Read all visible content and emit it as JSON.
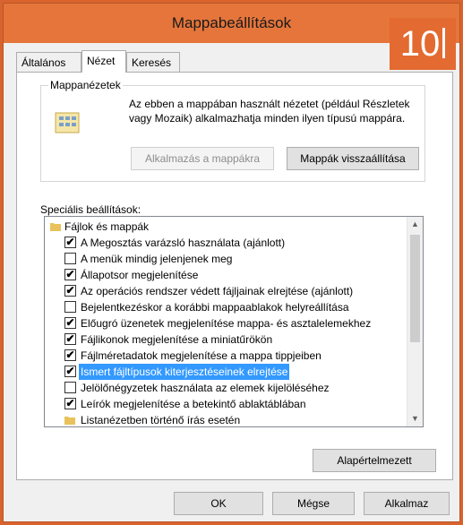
{
  "window": {
    "title": "Mappabeállítások",
    "badge": "10"
  },
  "tabs": [
    {
      "label": "Általános"
    },
    {
      "label": "Nézet"
    },
    {
      "label": "Keresés"
    }
  ],
  "folder_views": {
    "group_label": "Mappanézetek",
    "description": "Az ebben a mappában használt nézetet (például Részletek vagy Mozaik) alkalmazhatja minden ilyen típusú mappára.",
    "apply_button": "Alkalmazás a mappákra",
    "reset_button": "Mappák visszaállítása"
  },
  "advanced": {
    "label": "Speciális beállítások:",
    "items": [
      {
        "type": "folder",
        "label": "Fájlok és mappák"
      },
      {
        "type": "checkbox",
        "checked": "✔",
        "label": "A Megosztás varázsló használata (ajánlott)"
      },
      {
        "type": "checkbox",
        "checked": "",
        "label": "A menük mindig jelenjenek meg"
      },
      {
        "type": "checkbox",
        "checked": "✔",
        "label": "Állapotsor megjelenítése"
      },
      {
        "type": "checkbox",
        "checked": "✔",
        "label": "Az operációs rendszer védett fájljainak elrejtése (ajánlott)"
      },
      {
        "type": "checkbox",
        "checked": "",
        "label": "Bejelentkezéskor a korábbi mappaablakok helyreállítása"
      },
      {
        "type": "checkbox",
        "checked": "✔",
        "label": "Előugró üzenetek megjelenítése mappa- és asztalelemekhez"
      },
      {
        "type": "checkbox",
        "checked": "✔",
        "label": "Fájlikonok megjelenítése a miniatűrökön"
      },
      {
        "type": "checkbox",
        "checked": "✔",
        "label": "Fájlméretadatok megjelenítése a mappa tippjeiben"
      },
      {
        "type": "checkbox",
        "checked": "✔",
        "label": "Ismert fájltípusok kiterjesztéseinek elrejtése"
      },
      {
        "type": "checkbox",
        "checked": "",
        "label": "Jelölőnégyzetek használata az elemek kijelöléséhez"
      },
      {
        "type": "checkbox",
        "checked": "✔",
        "label": "Leírók megjelenítése a betekintő ablaktáblában"
      },
      {
        "type": "folder",
        "label": "Listanézetben történő írás esetén"
      }
    ],
    "defaults_button": "Alapértelmezett"
  },
  "footer": {
    "ok": "OK",
    "cancel": "Mégse",
    "apply": "Alkalmaz"
  },
  "colors": {
    "accent": "#e36a30",
    "selection": "#3399ff"
  }
}
